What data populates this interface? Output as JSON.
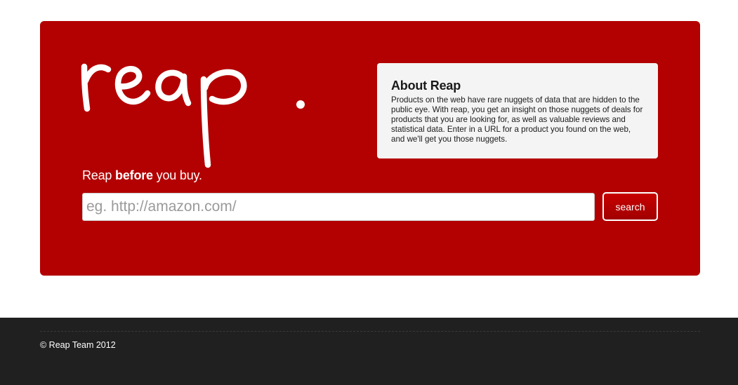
{
  "logo": {
    "text": "reap."
  },
  "tagline": {
    "prefix": "Reap ",
    "bold": "before",
    "suffix": " you buy."
  },
  "about": {
    "title": "About Reap",
    "body": "Products on the web have rare nuggets of data that are hidden to the public eye. With reap, you get an insight on those nuggets of deals for products that you are looking for, as well as valuable reviews and statistical data. Enter in a URL for a product you found on the web, and we'll get you those nuggets."
  },
  "search": {
    "placeholder": "eg. http://amazon.com/",
    "value": "",
    "button_label": "search"
  },
  "footer": {
    "copyright": "© Reap Team 2012"
  },
  "colors": {
    "hero_background": "#b30000",
    "about_background": "#f4f4f4",
    "footer_background": "#202020"
  }
}
